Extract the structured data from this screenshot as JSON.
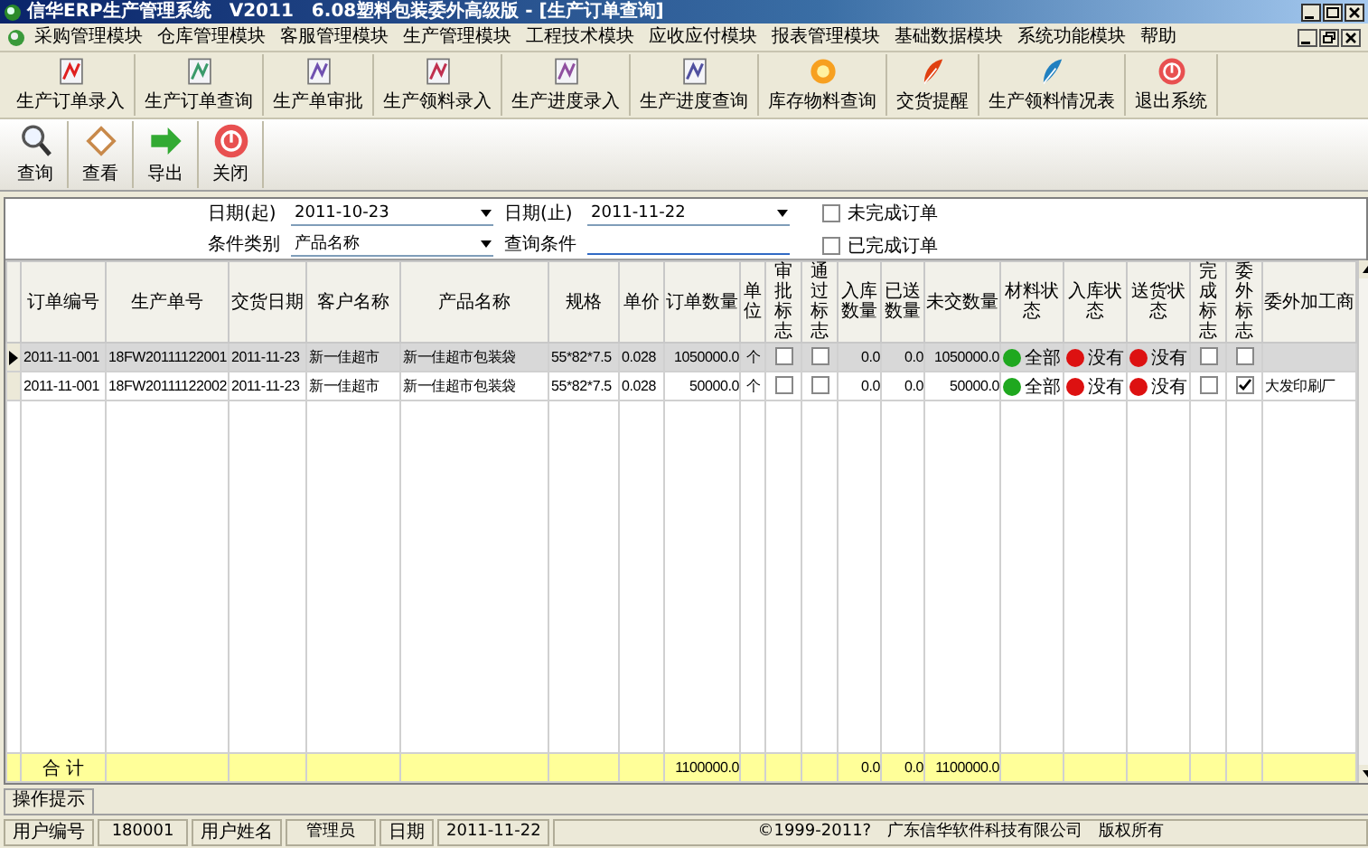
{
  "window": {
    "title": "信华ERP生产管理系统　V2011　6.08塑料包装委外高级版 - [生产订单查询]"
  },
  "menu": [
    "采购管理模块",
    "仓库管理模块",
    "客服管理模块",
    "生产管理模块",
    "工程技术模块",
    "应收应付模块",
    "报表管理模块",
    "基础数据模块",
    "系统功能模块",
    "帮助"
  ],
  "toolbar": [
    "生产订单录入",
    "生产订单查询",
    "生产单审批",
    "生产领料录入",
    "生产进度录入",
    "生产进度查询",
    "库存物料查询",
    "交货提醒",
    "生产领料情况表",
    "退出系统"
  ],
  "actions": [
    "查询",
    "查看",
    "导出",
    "关闭"
  ],
  "filters": {
    "date_from": {
      "label": "日期(起)",
      "value": "2011-10-23"
    },
    "date_to": {
      "label": "日期(止)",
      "value": "2011-11-22"
    },
    "condition_type": {
      "label": "条件类别",
      "value": "产品名称"
    },
    "condition": {
      "label": "查询条件"
    },
    "options": [
      {
        "label": "未完成订单",
        "checked": false
      },
      {
        "label": "已完成订单",
        "checked": false
      }
    ]
  },
  "table": {
    "columns": [
      {
        "label": "订单编号",
        "kind": "text"
      },
      {
        "label": "生产单号",
        "kind": "text"
      },
      {
        "label": "交货日期",
        "kind": "text"
      },
      {
        "label": "客户名称",
        "kind": "text"
      },
      {
        "label": "产品名称",
        "kind": "text"
      },
      {
        "label": "规格",
        "kind": "text"
      },
      {
        "label": "单价",
        "kind": "text"
      },
      {
        "label": "订单数量",
        "kind": "number"
      },
      {
        "label": "单位",
        "kind": "center"
      },
      {
        "label": "审批标志",
        "kind": "check"
      },
      {
        "label": "通过标志",
        "kind": "check"
      },
      {
        "label": "入库数量",
        "kind": "number"
      },
      {
        "label": "已送数量",
        "kind": "number"
      },
      {
        "label": "未交数量",
        "kind": "number"
      },
      {
        "label": "材料状态",
        "kind": "status"
      },
      {
        "label": "入库状态",
        "kind": "status"
      },
      {
        "label": "送货状态",
        "kind": "status"
      },
      {
        "label": "完成标志",
        "kind": "check"
      },
      {
        "label": "委外标志",
        "kind": "check"
      },
      {
        "label": "委外加工商",
        "kind": "text"
      }
    ],
    "rows": [
      {
        "selected": true,
        "cells": [
          "2011-11-001",
          "18FW20111122001",
          "2011-11-23",
          "新一佳超市",
          "新一佳超市包装袋",
          "55*82*7.5",
          "0.028",
          "1050000.0",
          "个",
          {
            "checked": false
          },
          {
            "checked": false
          },
          "0.0",
          "0.0",
          "1050000.0",
          {
            "label": "全部",
            "color": "#1fa81f"
          },
          {
            "label": "没有",
            "color": "#dd1111"
          },
          {
            "label": "没有",
            "color": "#dd1111"
          },
          {
            "checked": false
          },
          {
            "checked": false
          },
          null
        ]
      },
      {
        "selected": false,
        "cells": [
          "2011-11-001",
          "18FW20111122002",
          "2011-11-23",
          "新一佳超市",
          "新一佳超市包装袋",
          "55*82*7.5",
          "0.028",
          "50000.0",
          "个",
          {
            "checked": false
          },
          {
            "checked": false
          },
          "0.0",
          "0.0",
          "50000.0",
          {
            "label": "全部",
            "color": "#1fa81f"
          },
          {
            "label": "没有",
            "color": "#dd1111"
          },
          {
            "label": "没有",
            "color": "#dd1111"
          },
          {
            "checked": false
          },
          {
            "checked": true
          },
          "大发印刷厂"
        ]
      }
    ],
    "totals": {
      "label": "合 计",
      "cells": [
        null,
        null,
        null,
        null,
        null,
        null,
        "1100000.0",
        null,
        null,
        null,
        "0.0",
        "0.0",
        "1100000.0",
        null,
        null,
        null,
        null,
        null,
        null
      ]
    }
  },
  "hint_tab": "操作提示",
  "status_bar": {
    "fields": [
      {
        "label": "用户编号",
        "value": "180001"
      },
      {
        "label": "用户姓名",
        "value": "管理员"
      },
      {
        "label": "日期",
        "value": "2011-11-22"
      }
    ],
    "copyright": "©1999-2011?　广东信华软件科技有限公司　版权所有"
  }
}
